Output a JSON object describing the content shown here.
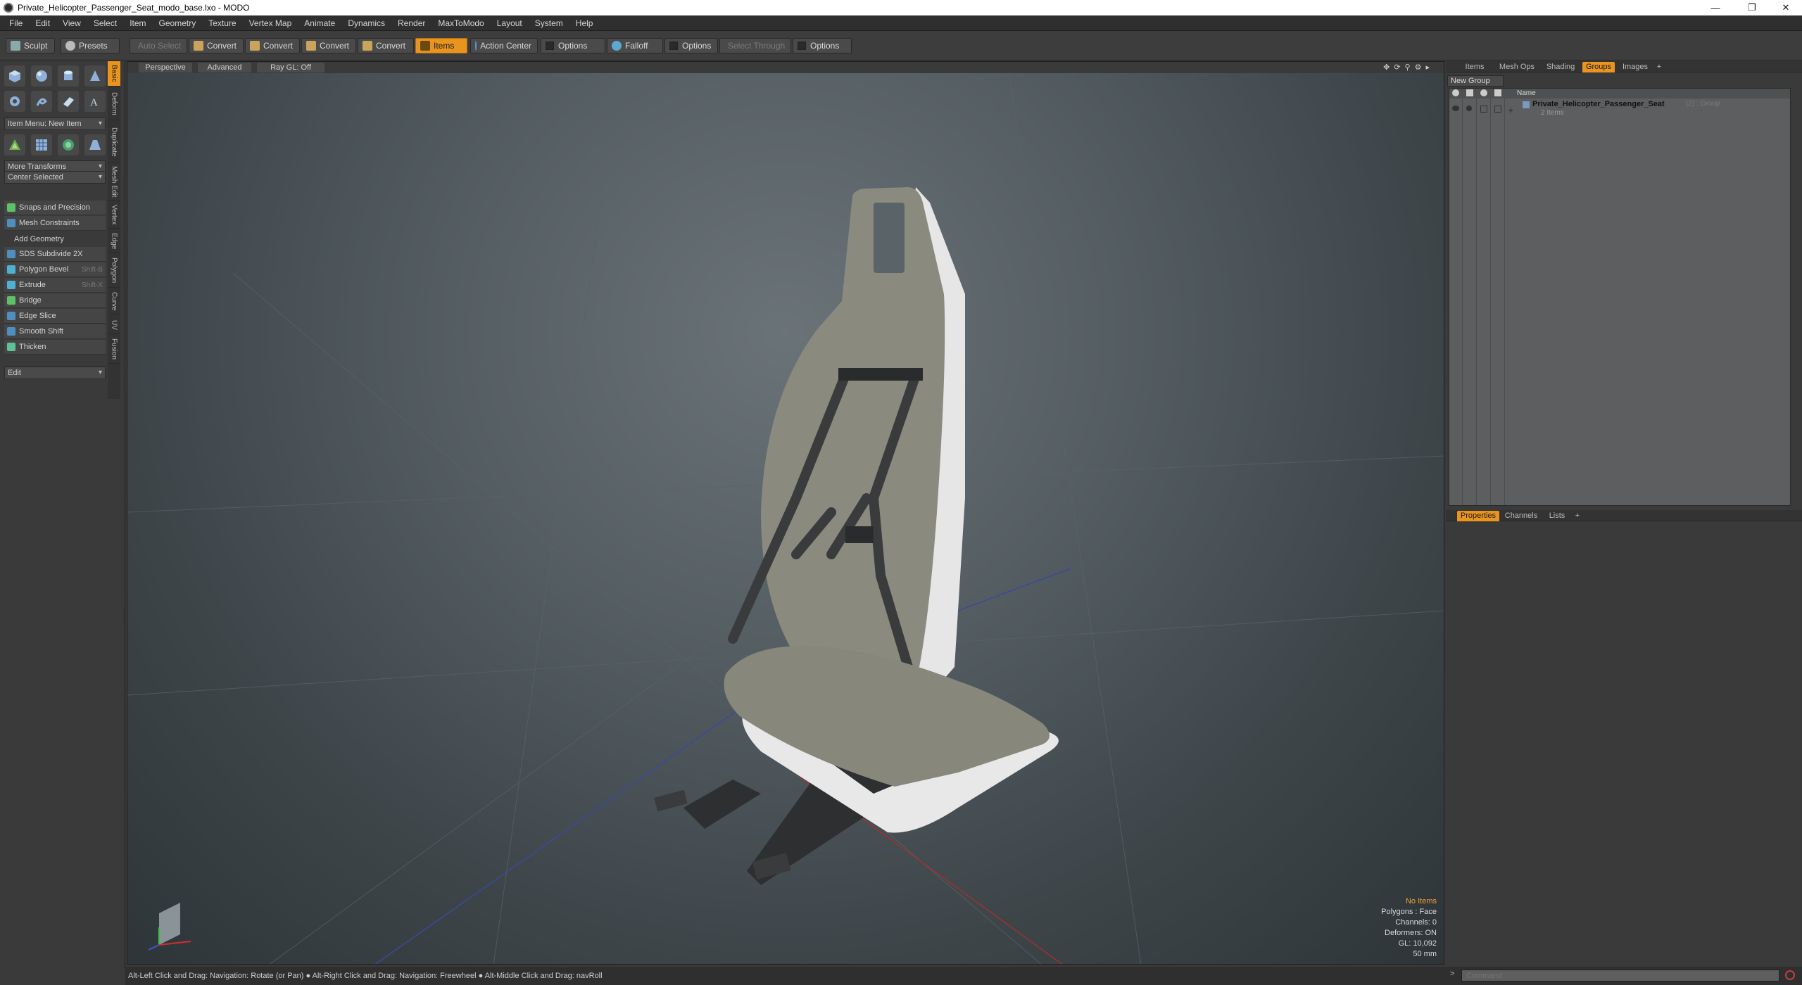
{
  "window": {
    "title": "Private_Helicopter_Passenger_Seat_modo_base.lxo - MODO",
    "minimize": "—",
    "restore": "❐",
    "close": "✕"
  },
  "menu": [
    "File",
    "Edit",
    "View",
    "Select",
    "Item",
    "Geometry",
    "Texture",
    "Vertex Map",
    "Animate",
    "Dynamics",
    "Render",
    "MaxToModo",
    "Layout",
    "System",
    "Help"
  ],
  "toolbar": {
    "sculpt": "Sculpt",
    "presets": "Presets",
    "auto_select": "Auto Select",
    "convert_1": "Convert",
    "convert_2": "Convert",
    "convert_3": "Convert",
    "convert_4": "Convert",
    "items": "Items",
    "action_center": "Action Center",
    "options_1": "Options",
    "falloff": "Falloff",
    "options_2": "Options",
    "select_through": "Select Through",
    "options_3": "Options"
  },
  "toolbox": {
    "item_menu": "Item Menu: New Item",
    "more_transforms": "More Transforms",
    "center_selected": "Center Selected",
    "snaps": "Snaps and Precision",
    "mesh_constraints": "Mesh Constraints",
    "add_geometry": "Add Geometry",
    "tools": [
      {
        "label": "SDS Subdivide 2X",
        "shortcut": "",
        "color": "#4f8fc0"
      },
      {
        "label": "Polygon Bevel",
        "shortcut": "Shift-B",
        "color": "#4fb0d0"
      },
      {
        "label": "Extrude",
        "shortcut": "Shift-X",
        "color": "#4fb0d0"
      },
      {
        "label": "Bridge",
        "shortcut": "",
        "color": "#5fc06a"
      },
      {
        "label": "Edge Slice",
        "shortcut": "",
        "color": "#4f8fc0"
      },
      {
        "label": "Smooth Shift",
        "shortcut": "",
        "color": "#4f8fc0"
      },
      {
        "label": "Thicken",
        "shortcut": "",
        "color": "#5fc09a"
      }
    ],
    "edit": "Edit",
    "vtabs": [
      "Basic",
      "Deform",
      "Duplicate",
      "Mesh Edit",
      "Vertex",
      "Edge",
      "Polygon",
      "Curve",
      "UV",
      "Fusion"
    ]
  },
  "viewport": {
    "tab_perspective": "Perspective",
    "tab_advanced": "Advanced",
    "tab_raygl": "Ray GL: Off",
    "info": {
      "no_items": "No Items",
      "polygons": "Polygons : Face",
      "channels": "Channels: 0",
      "deformers": "Deformers: ON",
      "gl": "GL: 10,092",
      "focal": "50 mm"
    }
  },
  "right_panel": {
    "tabs": [
      "Items",
      "Mesh Ops",
      "Shading",
      "Groups",
      "Images"
    ],
    "active_tab": "Groups",
    "add_tab": "+",
    "new_group": "New Group",
    "col_name": "Name",
    "group_name": "Private_Helicopter_Passenger_Seat",
    "group_count": "(2) : Group",
    "group_items": "2 Items",
    "lower_tabs": [
      "Properties",
      "Channels",
      "Lists"
    ],
    "lower_active": "Properties"
  },
  "status": {
    "hint": "Alt-Left Click and Drag: Navigation: Rotate (or Pan) ● Alt-Right Click and Drag: Navigation: Freewheel ● Alt-Middle Click and Drag: navRoll"
  },
  "command": {
    "placeholder": "Command"
  },
  "colors": {
    "accent": "#e8941f",
    "panel": "#3a3a3a",
    "seat_fabric": "#8a8b7e",
    "seat_white": "#e8e8e8",
    "frame": "#2a2b2c"
  }
}
